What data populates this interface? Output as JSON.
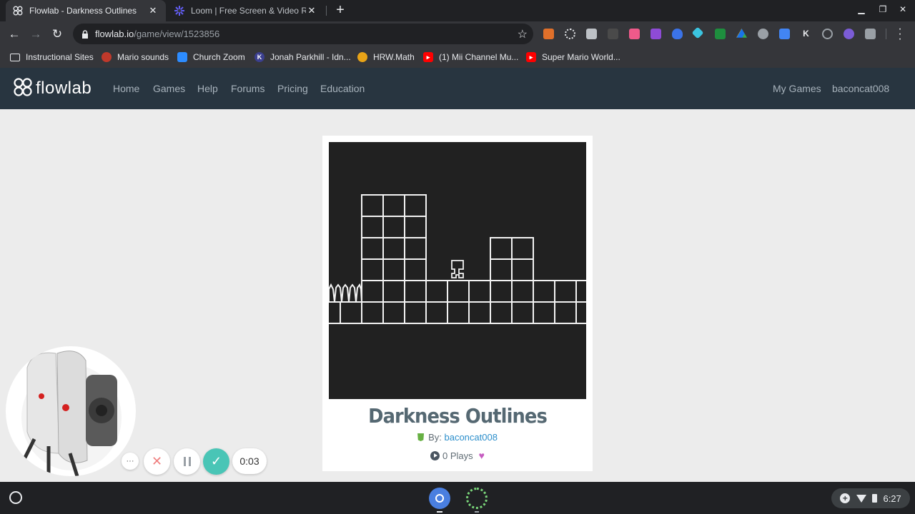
{
  "browser": {
    "tabs": [
      {
        "title": "Flowlab - Darkness Outlines",
        "active": true,
        "icon": "flowlab-logo-icon"
      },
      {
        "title": "Loom | Free Screen & Video Recording",
        "active": false,
        "icon": "loom-icon"
      }
    ],
    "new_tab_label": "+",
    "url_host": "flowlab.io",
    "url_path": "/game/view/1523856",
    "bookmarks": [
      {
        "label": "Instructional Sites",
        "icon": "folder-icon"
      },
      {
        "label": "Mario sounds",
        "icon": "mushroom-icon"
      },
      {
        "label": "Church Zoom",
        "icon": "zoom-icon"
      },
      {
        "label": "Jonah Parkhill - Idn...",
        "icon": "k-icon"
      },
      {
        "label": "HRW.Math",
        "icon": "hrw-icon"
      },
      {
        "label": "(1) Mii Channel Mu...",
        "icon": "youtube-icon"
      },
      {
        "label": "Super Mario World...",
        "icon": "youtube-icon"
      }
    ]
  },
  "site": {
    "logo_text": "flowlab",
    "nav": [
      "Home",
      "Games",
      "Help",
      "Forums",
      "Pricing",
      "Education"
    ],
    "right_nav": [
      "My Games",
      "baconcat008"
    ]
  },
  "game": {
    "title": "Darkness Outlines",
    "by_label": "By:",
    "author": "baconcat008",
    "plays": "0 Plays"
  },
  "loom": {
    "timer": "0:03",
    "more_label": "···"
  },
  "shelf": {
    "time": "6:27"
  },
  "colors": {
    "site_header": "#283540",
    "title": "#556872",
    "link": "#2b8ecb",
    "loom_confirm": "#49c5b6"
  }
}
